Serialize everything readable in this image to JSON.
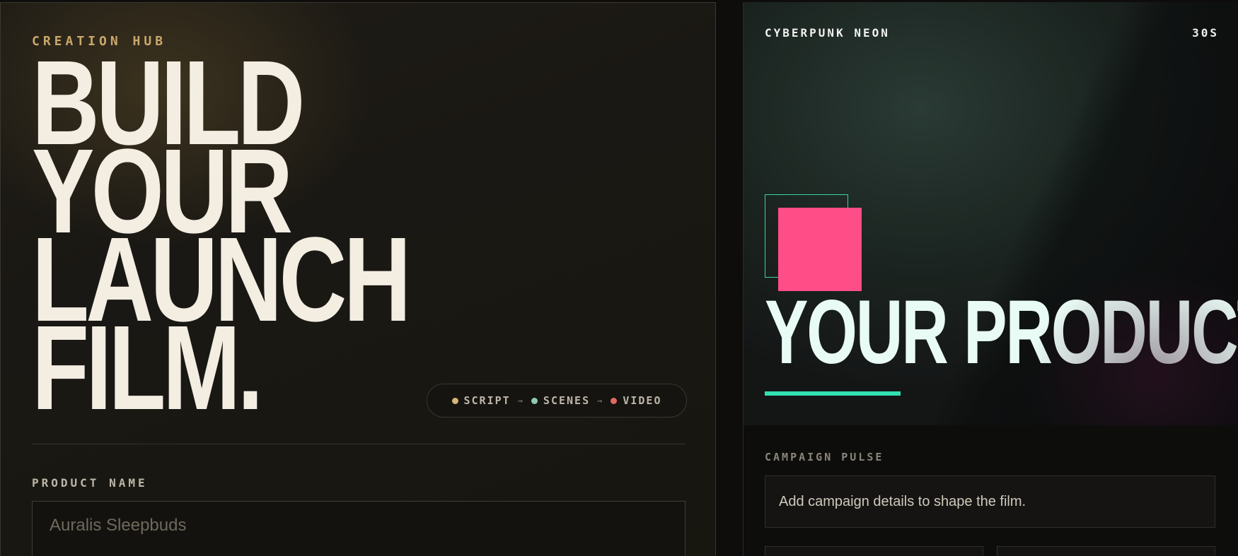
{
  "creation_hub": {
    "eyebrow": "CREATION HUB",
    "headline_lines": [
      "BUILD",
      "YOUR",
      "LAUNCH",
      "FILM."
    ],
    "pipeline": [
      {
        "label": "SCRIPT",
        "color": "#d6b577"
      },
      {
        "label": "SCENES",
        "color": "#8fc9b6"
      },
      {
        "label": "VIDEO",
        "color": "#e36a62"
      }
    ],
    "pipeline_arrow": "→",
    "product_field": {
      "label": "PRODUCT NAME",
      "value": "",
      "placeholder": "Auralis Sleepbuds"
    }
  },
  "preview": {
    "style_name": "CYBERPUNK NEON",
    "duration": "30S",
    "title": "YOUR PRODUCT",
    "colors": {
      "accent": "#33e0b1",
      "highlight": "#ff4d88",
      "outline": "#33d6a8"
    }
  },
  "campaign_pulse": {
    "label": "CAMPAIGN PULSE",
    "message": "Add campaign details to shape the film."
  }
}
